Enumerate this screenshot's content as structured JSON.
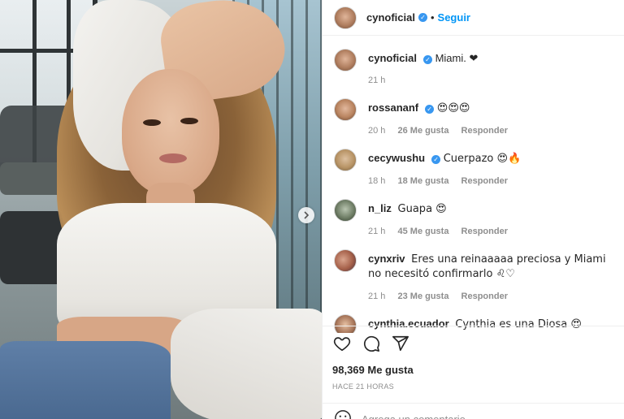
{
  "header": {
    "username": "cynoficial",
    "follow_label": "Seguir",
    "separator": "•"
  },
  "comments": [
    {
      "user": "cynoficial",
      "text": "Miami. ❤",
      "time": "21 h",
      "likes": "",
      "reply": ""
    },
    {
      "user": "rossananf",
      "text": "😍😍😍",
      "time": "20 h",
      "likes": "26 Me gusta",
      "reply": "Responder"
    },
    {
      "user": "cecywushu",
      "text": "Cuerpazo 😍🔥",
      "time": "18 h",
      "likes": "18 Me gusta",
      "reply": "Responder"
    },
    {
      "user": "n_liz",
      "text": "Guapa 😍",
      "time": "21 h",
      "likes": "45 Me gusta",
      "reply": "Responder"
    },
    {
      "user": "cynxriv",
      "text": "Eres una reinaaaaa preciosa y Miami no necesitó confirmarlo ♌♡",
      "time": "21 h",
      "likes": "23 Me gusta",
      "reply": "Responder"
    },
    {
      "user": "cynthia.ecuador",
      "text": "Cynthia es una Diosa 😍 Miami me lo",
      "time": "",
      "likes": "",
      "reply": ""
    }
  ],
  "post": {
    "likes": "98,369 Me gusta",
    "time_ago": "HACE 21 HORAS"
  },
  "add_comment": {
    "placeholder": "Agrega un comentario..."
  },
  "icons": {
    "like": "heart-icon",
    "comment": "comment-icon",
    "share": "send-icon",
    "emoji": "emoji-icon",
    "next": "chevron-right-icon"
  },
  "colors": {
    "accent": "#0095f6",
    "verified": "#3897f0",
    "muted": "#8e8e8e"
  }
}
